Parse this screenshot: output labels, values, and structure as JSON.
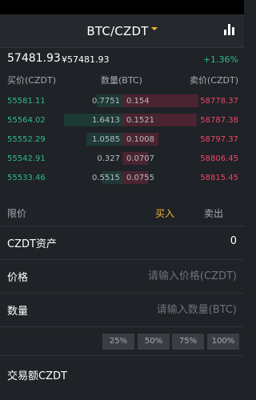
{
  "nav": {
    "pair": "BTC/CZDT",
    "chart_icon": "bar-chart-icon"
  },
  "ticker": {
    "last_price": "57481.93",
    "cny_price": "¥57481.93",
    "change": "+1.36%"
  },
  "orderbook": {
    "headers": {
      "bid_price": "买价(CZDT)",
      "qty": "数量(BTC)",
      "ask_price": "卖价(CZDT)"
    },
    "rows": [
      {
        "bid_price": "55581.11",
        "bid_qty": "0.7751",
        "bid_depth": 0.32,
        "ask_qty": "0.154",
        "ask_depth": 0.95,
        "ask_price": "58778.37"
      },
      {
        "bid_price": "55564.02",
        "bid_qty": "1.6413",
        "bid_depth": 0.73,
        "ask_qty": "0.1521",
        "ask_depth": 0.93,
        "ask_price": "58787.38"
      },
      {
        "bid_price": "55552.29",
        "bid_qty": "1.0585",
        "bid_depth": 0.45,
        "ask_qty": "0.1008",
        "ask_depth": 0.45,
        "ask_price": "58797.37"
      },
      {
        "bid_price": "55542.91",
        "bid_qty": "0.327",
        "bid_depth": 0.0,
        "ask_qty": "0.0707",
        "ask_depth": 0.32,
        "ask_price": "58806.45"
      },
      {
        "bid_price": "55533.46",
        "bid_qty": "0.5515",
        "bid_depth": 0.25,
        "ask_qty": "0.0755",
        "ask_depth": 0.32,
        "ask_price": "58815.45"
      }
    ],
    "colors": {
      "bid": "#2fbc8a",
      "ask": "#f0456b"
    }
  },
  "trade": {
    "order_type": "限价",
    "buy_tab": "买入",
    "sell_tab": "卖出",
    "asset_label": "CZDT资产",
    "asset_value": "0",
    "price_label": "价格",
    "price_placeholder": "请输入价格(CZDT)",
    "qty_label": "数量",
    "qty_placeholder": "请输入数量(BTC)",
    "percent_options": [
      "25%",
      "50%",
      "75%",
      "100%"
    ],
    "total_label": "交易额CZDT"
  },
  "colors": {
    "accent": "#f2b53a",
    "up": "#2fbc8a",
    "down": "#f0456b"
  }
}
